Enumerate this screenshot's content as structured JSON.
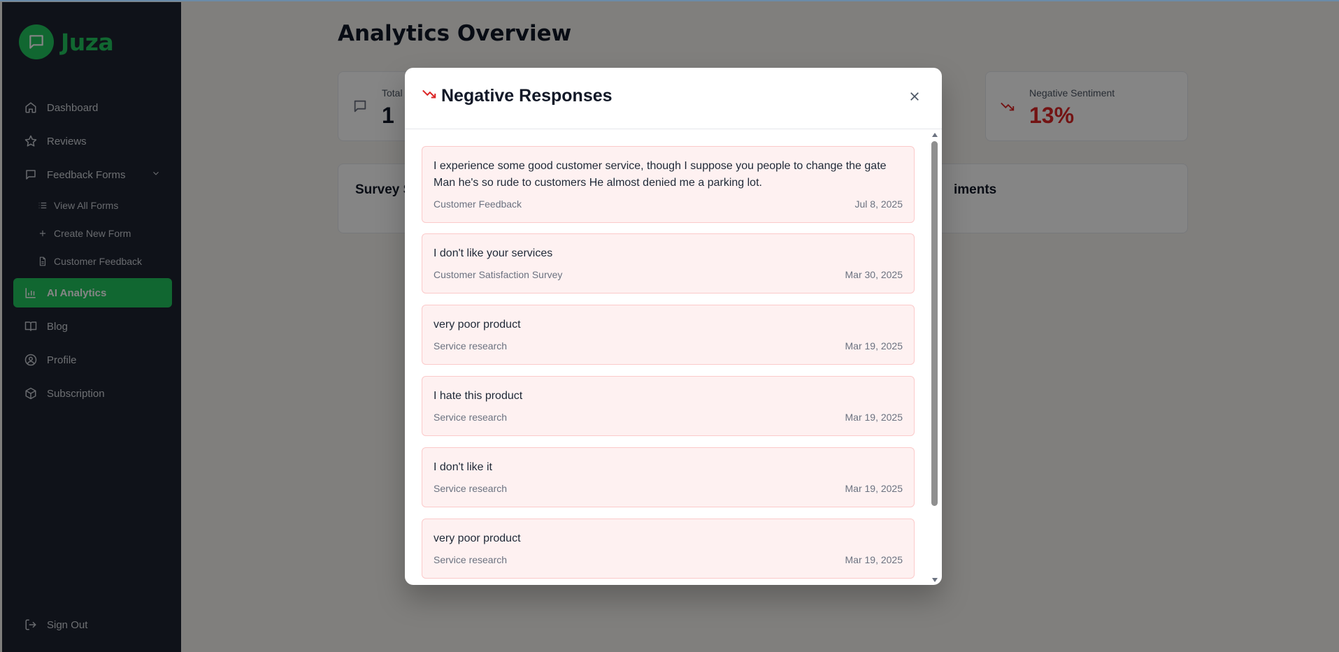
{
  "brand": {
    "name": "Juza",
    "color": "#22c55e"
  },
  "sidebar": {
    "items": [
      {
        "label": "Dashboard",
        "icon": "home-icon"
      },
      {
        "label": "Reviews",
        "icon": "star-icon"
      },
      {
        "label": "Feedback Forms",
        "icon": "message-square-icon",
        "expanded": true
      },
      {
        "label": "View All Forms",
        "icon": "list-icon"
      },
      {
        "label": "Create New Form",
        "icon": "plus-icon"
      },
      {
        "label": "Customer Feedback",
        "icon": "file-icon"
      },
      {
        "label": "AI Analytics",
        "icon": "bar-chart-icon",
        "active": true
      },
      {
        "label": "Blog",
        "icon": "book-open-icon"
      },
      {
        "label": "Profile",
        "icon": "user-circle-icon"
      },
      {
        "label": "Subscription",
        "icon": "package-icon"
      }
    ],
    "sign_out": "Sign Out"
  },
  "page": {
    "title": "Analytics Overview",
    "stats": [
      {
        "label": "Total",
        "value": "1"
      },
      {
        "label": "Negative Sentiment",
        "value": "13%"
      }
    ],
    "panels": [
      {
        "title": "Survey S"
      },
      {
        "title": "iments"
      }
    ]
  },
  "modal": {
    "title": "Negative Responses",
    "responses": [
      {
        "text": "I experience some good customer service, though I suppose you people to change the gate Man he's so rude to customers He almost denied me a parking lot.",
        "form": "Customer Feedback",
        "date": "Jul 8, 2025"
      },
      {
        "text": "I don't like your services",
        "form": "Customer Satisfaction Survey",
        "date": "Mar 30, 2025"
      },
      {
        "text": "very poor product",
        "form": "Service research",
        "date": "Mar 19, 2025"
      },
      {
        "text": "I hate this product",
        "form": "Service research",
        "date": "Mar 19, 2025"
      },
      {
        "text": "I don't like it",
        "form": "Service research",
        "date": "Mar 19, 2025"
      },
      {
        "text": "very poor product",
        "form": "Service research",
        "date": "Mar 19, 2025"
      }
    ]
  },
  "colors": {
    "sidebar_bg": "#1d2330",
    "accent": "#22c55e",
    "negative": "#dc2626",
    "response_bg": "#fef1f1",
    "response_border": "#fbcaca"
  }
}
